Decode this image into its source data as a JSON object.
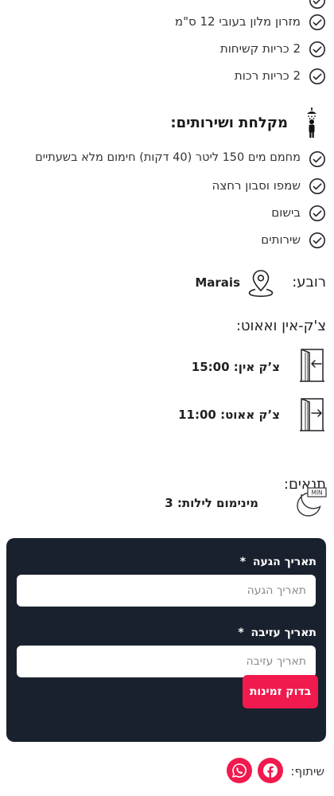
{
  "bedding": {
    "items": [
      {
        "label": "מזרון מלון בעובי 12 ס\"מ"
      },
      {
        "label": "2 כריות קשיחות"
      },
      {
        "label": "2 כריות רכות"
      }
    ]
  },
  "bathroom": {
    "title": "מקלחת ושירותים:",
    "items": [
      {
        "label": "מחמם מים 150 ליטר (40 דקות) חימום מלא בשעתיים"
      },
      {
        "label": "שמפו וסבון רחצה"
      },
      {
        "label": "בישום"
      },
      {
        "label": "שירותים"
      }
    ]
  },
  "neighborhood": {
    "label": "רובע:",
    "value": "Marais"
  },
  "checkinout": {
    "title": "צ'ק-אין ואאוט:",
    "checkin": "צ’ק אין: 15:00",
    "checkout": "צ’ק אאוט: 11:00"
  },
  "conditions": {
    "title": "תנאים:",
    "min_nights": "מינימום לילות: 3",
    "moon_badge": "MIN"
  },
  "booking_form": {
    "arrival_label": "תאריך הגעה",
    "arrival_placeholder": "תאריך הגעה",
    "departure_label": "תאריך עזיבה",
    "departure_placeholder": "תאריך עזיבה",
    "required_mark": "*",
    "submit_label": "בדוק זמינות"
  },
  "share": {
    "label": "שיתוף:"
  },
  "colors": {
    "accent": "#f01a4e",
    "panel": "#1a212e"
  }
}
